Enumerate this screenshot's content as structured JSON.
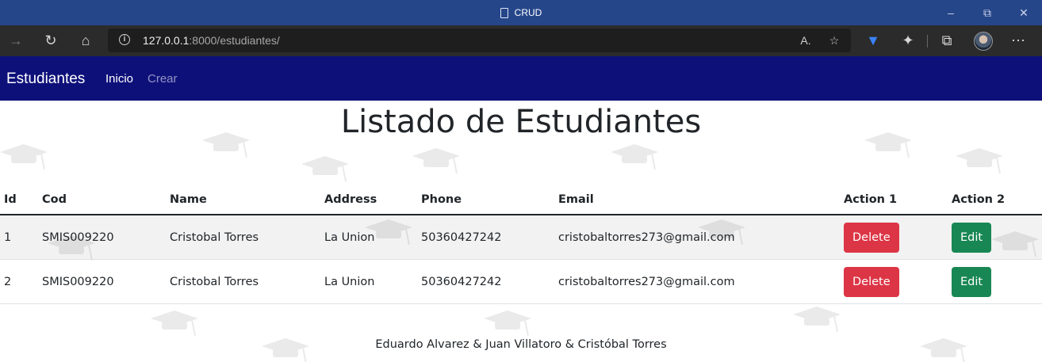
{
  "window": {
    "title": "CRUD"
  },
  "browser": {
    "url_host": "127.0.0.1",
    "url_rest": ":8000/estudiantes/"
  },
  "navbar": {
    "brand": "Estudiantes",
    "links": [
      {
        "label": "Inicio",
        "active": true
      },
      {
        "label": "Crear",
        "active": false
      }
    ]
  },
  "page": {
    "title": "Listado de Estudiantes",
    "table": {
      "headers": [
        "Id",
        "Cod",
        "Name",
        "Address",
        "Phone",
        "Email",
        "Action 1",
        "Action 2"
      ],
      "rows": [
        {
          "id": "1",
          "cod": "SMIS009220",
          "name": "Cristobal Torres",
          "address": "La Union",
          "phone": "50360427242",
          "email": "cristobaltorres273@gmail.com",
          "delete_label": "Delete",
          "edit_label": "Edit"
        },
        {
          "id": "2",
          "cod": "SMIS009220",
          "name": "Cristobal Torres",
          "address": "La Union",
          "phone": "50360427242",
          "email": "cristobaltorres273@gmail.com",
          "delete_label": "Delete",
          "edit_label": "Edit"
        }
      ]
    },
    "footer": "Eduardo Alvarez & Juan Villatoro & Cristóbal Torres"
  },
  "colors": {
    "titlebar": "#26468a",
    "navbar": "#0e107a",
    "danger": "#dc3545",
    "success": "#198754"
  }
}
